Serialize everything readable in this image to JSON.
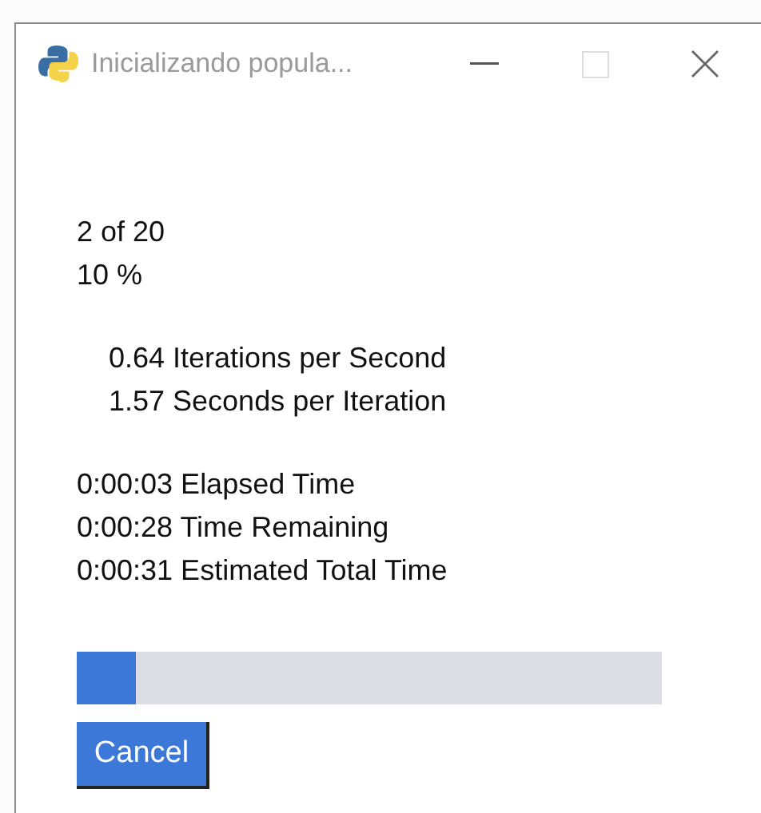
{
  "window": {
    "title": "Inicializando popula..."
  },
  "progress_lines": [
    "2 of 20",
    "10 %"
  ],
  "rate_lines": [
    "0.64 Iterations per Second",
    "1.57 Seconds per Iteration"
  ],
  "time_lines": [
    "0:00:03 Elapsed Time",
    "0:00:28 Time Remaining",
    "0:00:31 Estimated Total Time"
  ],
  "progress_bar": {
    "level": 0.1
  },
  "buttons": [
    "Cancel"
  ]
}
